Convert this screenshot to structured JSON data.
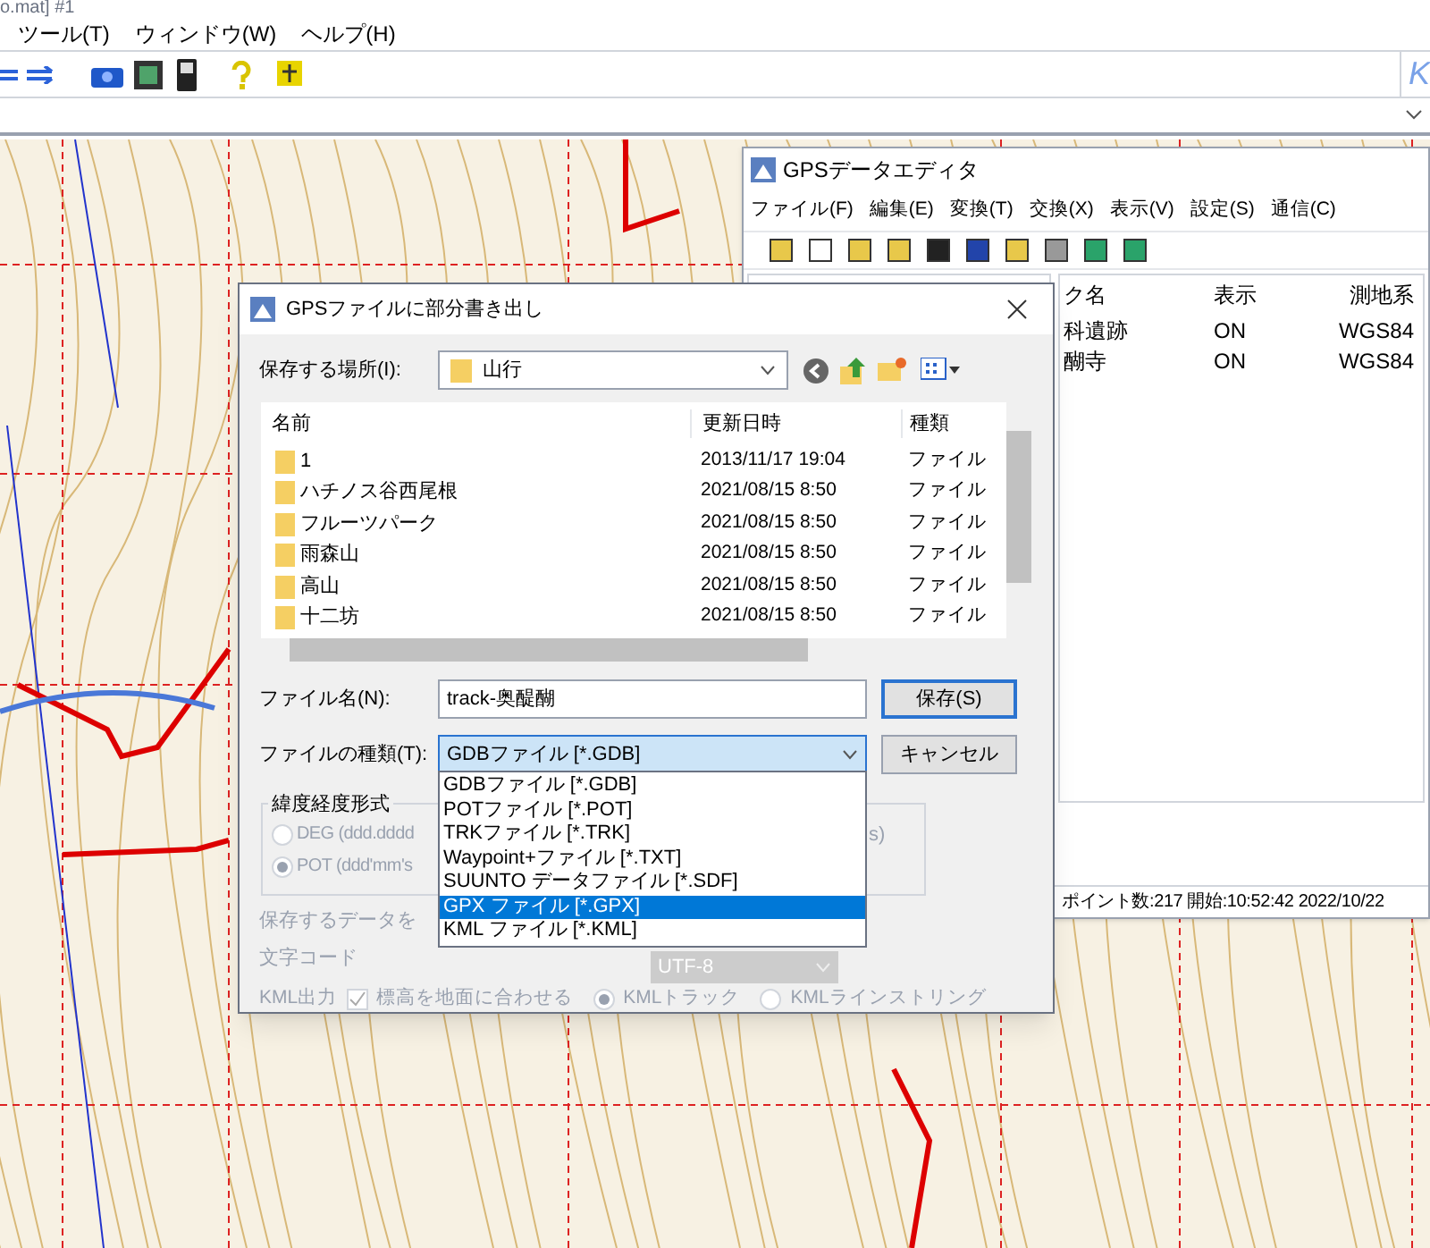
{
  "main_window": {
    "title": "o.mat] #1",
    "menu": [
      "ツール(T)",
      "ウィンドウ(W)",
      "ヘルプ(H)"
    ],
    "logo_letter": "K"
  },
  "gps_editor": {
    "title": "GPSデータエディタ",
    "menu": [
      "ファイル(F)",
      "編集(E)",
      "変換(T)",
      "交換(X)",
      "表示(V)",
      "設定(S)",
      "通信(C)"
    ],
    "columns": [
      "ク名",
      "表示",
      "測地系"
    ],
    "rows": [
      [
        "科遺跡",
        "ON",
        "WGS84"
      ],
      [
        "醐寺",
        "ON",
        "WGS84"
      ]
    ],
    "status": "ポイント数:217 開始:10:52:42 2022/10/22"
  },
  "dialog": {
    "title": "GPSファイルに部分書き出し",
    "save_in_label": "保存する場所(I):",
    "save_in_value": "山行",
    "columns": [
      "名前",
      "更新日時",
      "種類"
    ],
    "files": [
      {
        "name": "1",
        "modified": "2013/11/17 19:04",
        "type": "ファイル"
      },
      {
        "name": "ハチノス谷西尾根",
        "modified": "2021/08/15 8:50",
        "type": "ファイル"
      },
      {
        "name": "フルーツパーク",
        "modified": "2021/08/15 8:50",
        "type": "ファイル"
      },
      {
        "name": "雨森山",
        "modified": "2021/08/15 8:50",
        "type": "ファイル"
      },
      {
        "name": "高山",
        "modified": "2021/08/15 8:50",
        "type": "ファイル"
      },
      {
        "name": "十二坊",
        "modified": "2021/08/15 8:50",
        "type": "ファイル"
      }
    ],
    "filename_label": "ファイル名(N):",
    "filename_value": "track-奥醍醐",
    "type_label": "ファイルの種類(T):",
    "type_value": "GDBファイル [*.GDB]",
    "save_button": "保存(S)",
    "cancel_button": "キャンセル",
    "type_options": [
      {
        "label": "GDBファイル [*.GDB]",
        "selected": false
      },
      {
        "label": "POTファイル [*.POT]",
        "selected": false
      },
      {
        "label": "TRKファイル [*.TRK]",
        "selected": false
      },
      {
        "label": "Waypoint+ファイル [*.TXT]",
        "selected": false
      },
      {
        "label": "SUUNTO データファイル [*.SDF]",
        "selected": false
      },
      {
        "label": "GPX ファイル [*.GPX]",
        "selected": true
      },
      {
        "label": "KML ファイル [*.KML]",
        "selected": false
      }
    ],
    "coord_group": {
      "title": "緯度経度形式",
      "options": [
        {
          "label": "DEG (ddd.dddd",
          "selected": false
        },
        {
          "label": "POT (ddd'mm's",
          "selected": true
        }
      ],
      "right_fragment": "s)"
    },
    "data_label": "保存するデータを",
    "encoding_label": "文字コード",
    "encoding_value": "UTF-8",
    "kml_label": "KML出力",
    "kml_ground": {
      "label": "標高を地面に合わせる",
      "checked": true
    },
    "kml_modes": [
      {
        "label": "KMLトラック",
        "selected": true
      },
      {
        "label": "KMLラインストリング",
        "selected": false
      }
    ]
  }
}
